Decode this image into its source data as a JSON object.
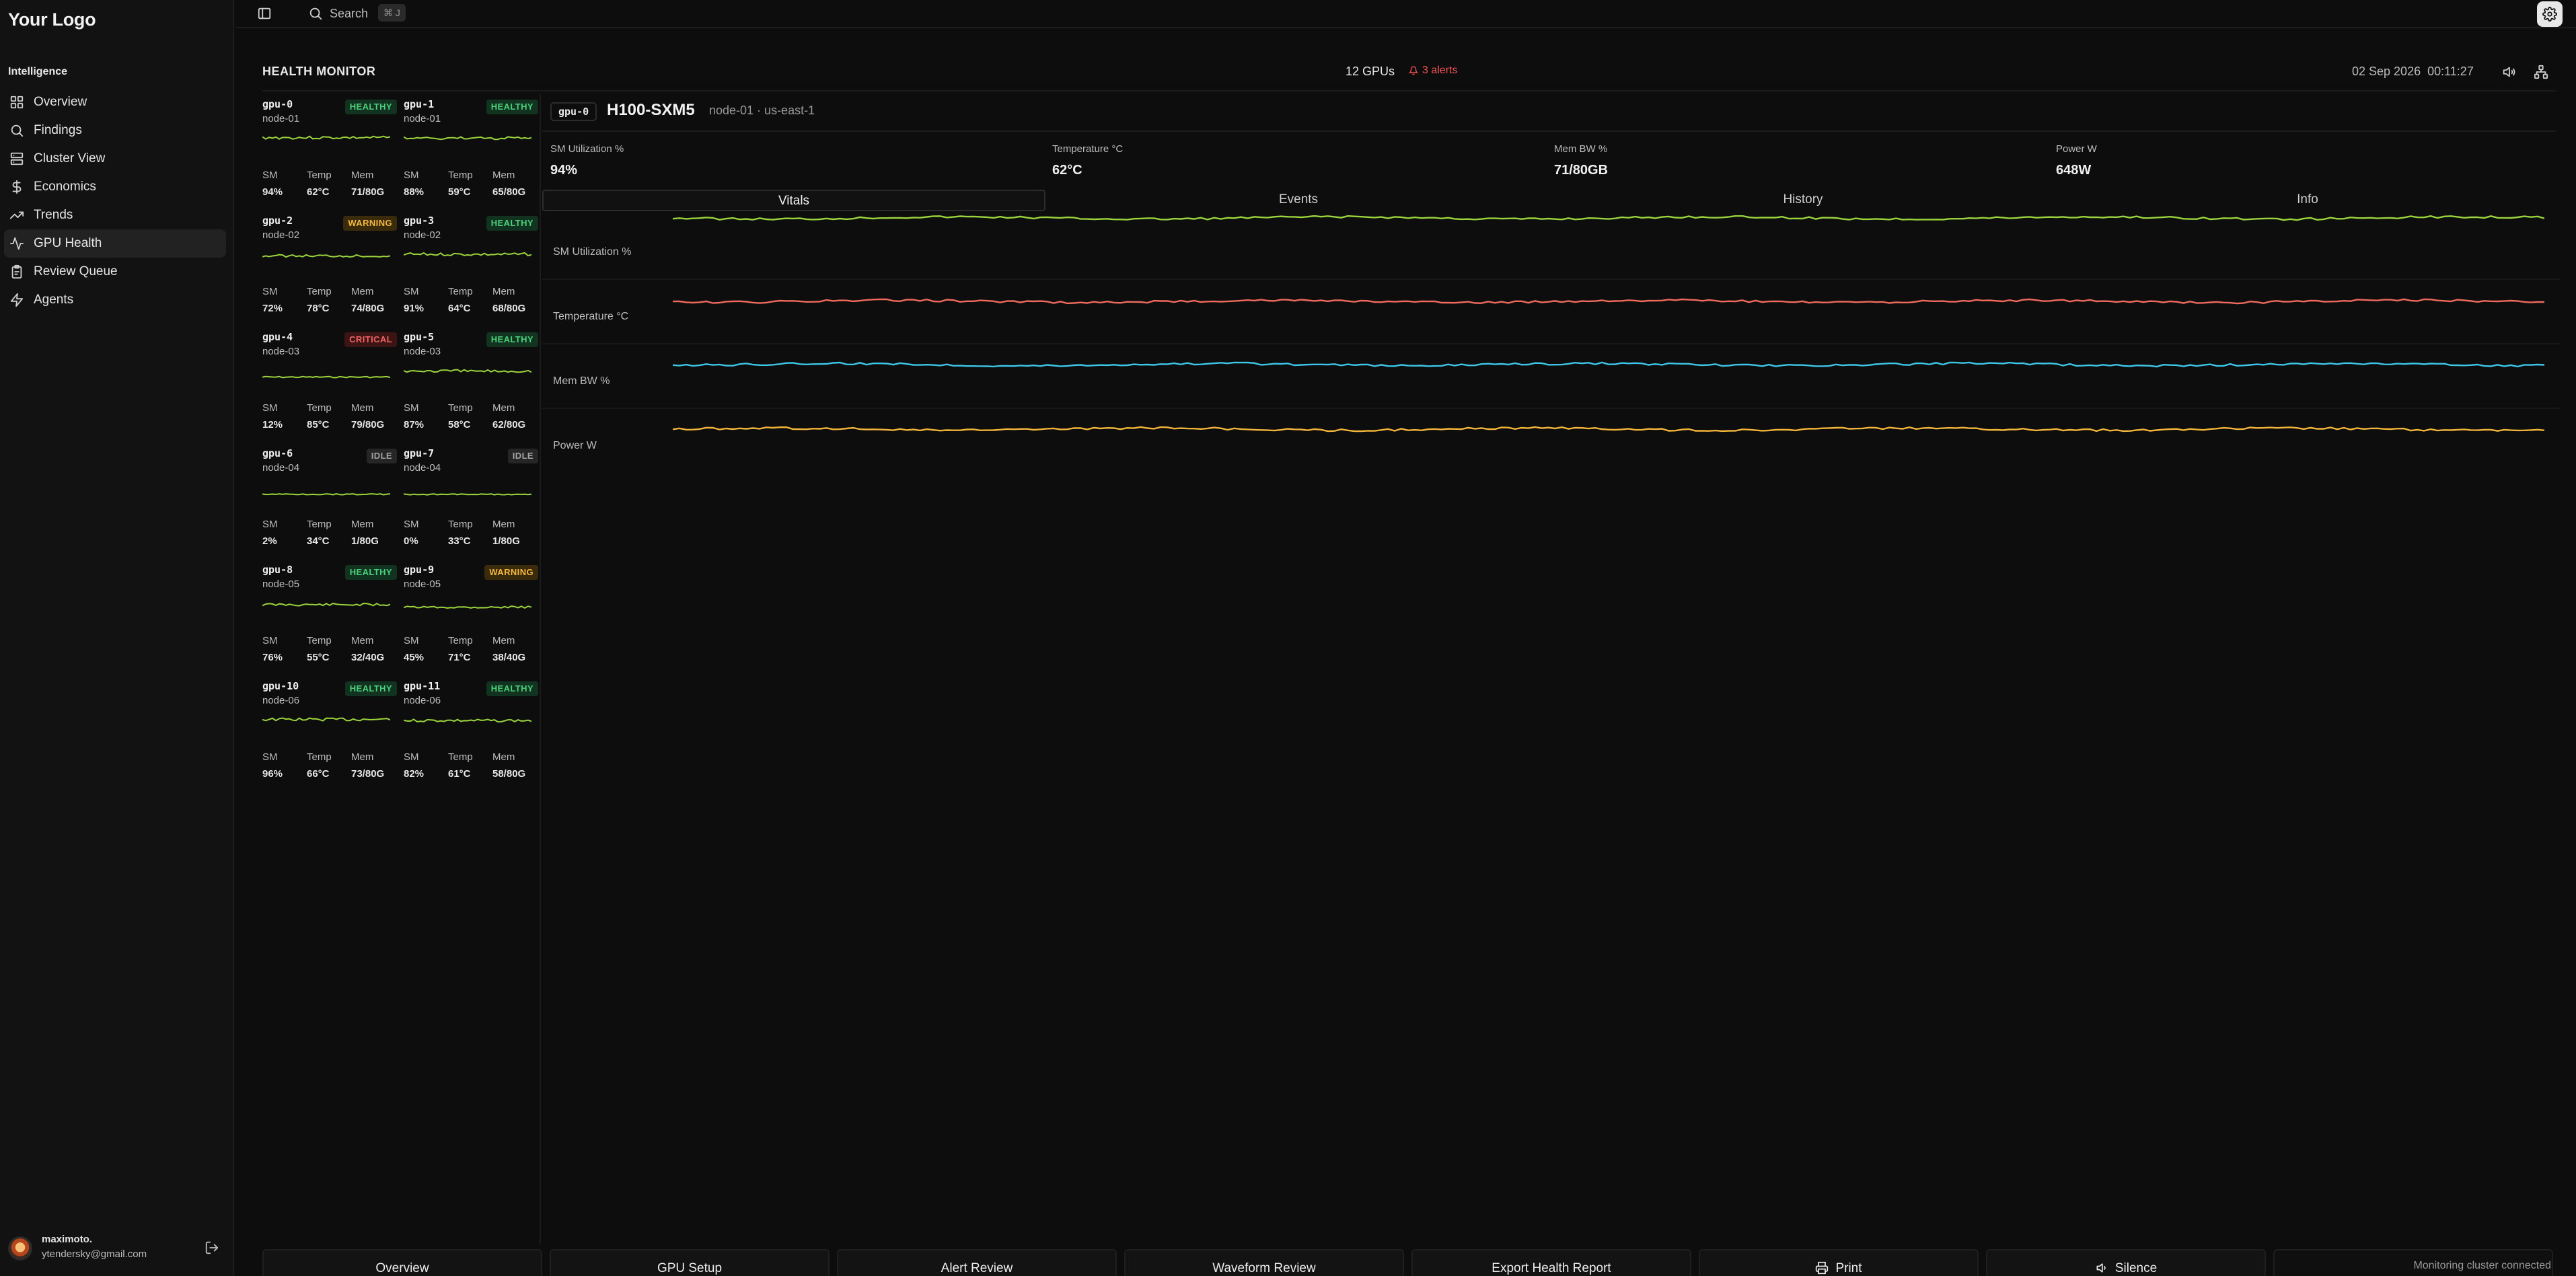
{
  "app": {
    "logo": "Your Logo"
  },
  "sidebar": {
    "section": "Intelligence",
    "items": [
      {
        "label": "Overview",
        "icon": "layout-grid-icon",
        "active": false
      },
      {
        "label": "Findings",
        "icon": "search-icon",
        "active": false
      },
      {
        "label": "Cluster View",
        "icon": "server-icon",
        "active": false
      },
      {
        "label": "Economics",
        "icon": "dollar-icon",
        "active": false
      },
      {
        "label": "Trends",
        "icon": "trending-up-icon",
        "active": false
      },
      {
        "label": "GPU Health",
        "icon": "activity-icon",
        "active": true
      },
      {
        "label": "Review Queue",
        "icon": "clipboard-icon",
        "active": false
      },
      {
        "label": "Agents",
        "icon": "lightning-icon",
        "active": false
      }
    ],
    "user": {
      "name": "maximoto.",
      "email": "ytendersky@gmail.com"
    }
  },
  "topbar": {
    "search_placeholder": "Search",
    "search_shortcut": "⌘ J"
  },
  "header": {
    "title": "HEALTH MONITOR",
    "gpu_count": "12 GPUs",
    "alerts": "3 alerts",
    "timestamp": "02 Sep 2026  00:11:27"
  },
  "gpu_metric_labels": [
    "SM",
    "Temp",
    "Mem"
  ],
  "gpus": [
    {
      "id": "gpu-0",
      "node": "node-01",
      "status": "HEALTHY",
      "sm": "94%",
      "temp": "62°C",
      "mem": "71/80G",
      "sm_fraction": 0.94
    },
    {
      "id": "gpu-1",
      "node": "node-01",
      "status": "HEALTHY",
      "sm": "88%",
      "temp": "59°C",
      "mem": "65/80G",
      "sm_fraction": 0.88
    },
    {
      "id": "gpu-2",
      "node": "node-02",
      "status": "WARNING",
      "sm": "72%",
      "temp": "78°C",
      "mem": "74/80G",
      "sm_fraction": 0.72
    },
    {
      "id": "gpu-3",
      "node": "node-02",
      "status": "HEALTHY",
      "sm": "91%",
      "temp": "64°C",
      "mem": "68/80G",
      "sm_fraction": 0.91
    },
    {
      "id": "gpu-4",
      "node": "node-03",
      "status": "CRITICAL",
      "sm": "12%",
      "temp": "85°C",
      "mem": "79/80G",
      "sm_fraction": 0.12
    },
    {
      "id": "gpu-5",
      "node": "node-03",
      "status": "HEALTHY",
      "sm": "87%",
      "temp": "58°C",
      "mem": "62/80G",
      "sm_fraction": 0.87
    },
    {
      "id": "gpu-6",
      "node": "node-04",
      "status": "IDLE",
      "sm": "2%",
      "temp": "34°C",
      "mem": "1/80G",
      "sm_fraction": 0.02
    },
    {
      "id": "gpu-7",
      "node": "node-04",
      "status": "IDLE",
      "sm": "0%",
      "temp": "33°C",
      "mem": "1/80G",
      "sm_fraction": 0.0
    },
    {
      "id": "gpu-8",
      "node": "node-05",
      "status": "HEALTHY",
      "sm": "76%",
      "temp": "55°C",
      "mem": "32/40G",
      "sm_fraction": 0.76
    },
    {
      "id": "gpu-9",
      "node": "node-05",
      "status": "WARNING",
      "sm": "45%",
      "temp": "71°C",
      "mem": "38/40G",
      "sm_fraction": 0.45
    },
    {
      "id": "gpu-10",
      "node": "node-06",
      "status": "HEALTHY",
      "sm": "96%",
      "temp": "66°C",
      "mem": "73/80G",
      "sm_fraction": 0.96
    },
    {
      "id": "gpu-11",
      "node": "node-06",
      "status": "HEALTHY",
      "sm": "82%",
      "temp": "61°C",
      "mem": "58/80G",
      "sm_fraction": 0.82
    }
  ],
  "detail": {
    "gpu_id": "gpu-0",
    "model": "H100-SXM5",
    "location": "node-01 · us-east-1",
    "stats": [
      {
        "label": "SM Utilization %",
        "value": "94%"
      },
      {
        "label": "Temperature °C",
        "value": "62°C"
      },
      {
        "label": "Mem BW %",
        "value": "71/80GB"
      },
      {
        "label": "Power W",
        "value": "648W"
      }
    ],
    "tabs": [
      "Vitals",
      "Events",
      "History",
      "Info"
    ],
    "active_tab": "Vitals",
    "vitals": [
      {
        "label": "SM Utilization %",
        "color": "#9bd43c"
      },
      {
        "label": "Temperature °C",
        "color": "#f06a5e"
      },
      {
        "label": "Mem BW %",
        "color": "#3ec6e8"
      },
      {
        "label": "Power W",
        "color": "#f2b53a"
      }
    ]
  },
  "colors": {
    "spark": "#9bd43c",
    "alert": "#f05252",
    "background": "#0d0d0d"
  },
  "bottombar": {
    "buttons": [
      {
        "label": "Overview",
        "icon": ""
      },
      {
        "label": "GPU Setup",
        "icon": ""
      },
      {
        "label": "Alert Review",
        "icon": ""
      },
      {
        "label": "Waveform Review",
        "icon": ""
      },
      {
        "label": "Export Health Report",
        "icon": ""
      },
      {
        "label": "Print",
        "icon": "printer-icon"
      },
      {
        "label": "Silence",
        "icon": "speaker-off-icon"
      }
    ],
    "status": "Monitoring cluster connected"
  }
}
